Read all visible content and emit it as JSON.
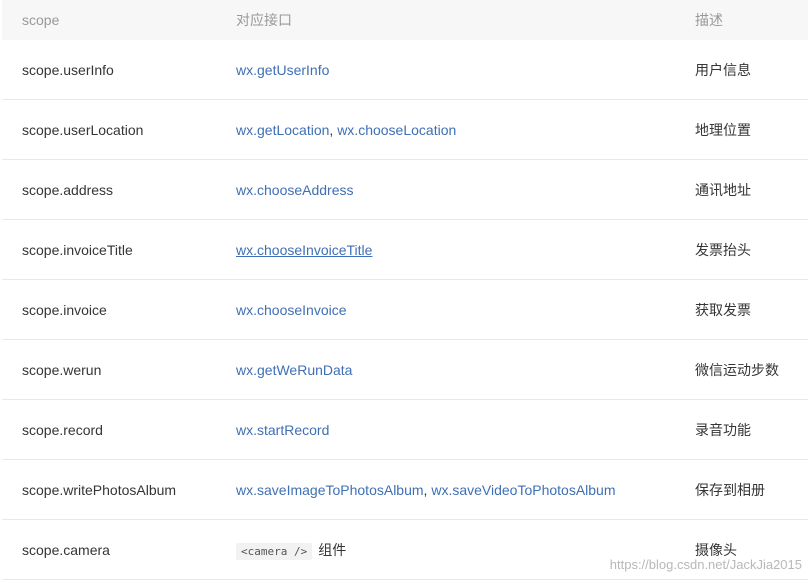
{
  "header": {
    "scope": "scope",
    "api": "对应接口",
    "desc": "描述"
  },
  "rows": [
    {
      "scope": "scope.userInfo",
      "apis": [
        "wx.getUserInfo"
      ],
      "desc": "用户信息"
    },
    {
      "scope": "scope.userLocation",
      "apis": [
        "wx.getLocation",
        "wx.chooseLocation"
      ],
      "sep": ", ",
      "desc": "地理位置"
    },
    {
      "scope": "scope.address",
      "apis": [
        "wx.chooseAddress"
      ],
      "desc": "通讯地址"
    },
    {
      "scope": "scope.invoiceTitle",
      "apis": [
        "wx.chooseInvoiceTitle"
      ],
      "desc": "发票抬头"
    },
    {
      "scope": "scope.invoice",
      "apis": [
        "wx.chooseInvoice"
      ],
      "desc": "获取发票"
    },
    {
      "scope": "scope.werun",
      "apis": [
        "wx.getWeRunData"
      ],
      "desc": "微信运动步数"
    },
    {
      "scope": "scope.record",
      "apis": [
        "wx.startRecord"
      ],
      "desc": "录音功能"
    },
    {
      "scope": "scope.writePhotosAlbum",
      "apis": [
        "wx.saveImageToPhotosAlbum",
        "wx.saveVideoToPhotosAlbum"
      ],
      "sep": ", ",
      "desc": "保存到相册"
    },
    {
      "scope": "scope.camera",
      "code": "<camera />",
      "component_label": "组件",
      "desc": "摄像头"
    }
  ],
  "watermark": "https://blog.csdn.net/JackJia2015",
  "colors": {
    "link": "#3f6fb5",
    "header_bg": "#f7f7f7",
    "row_border": "#e8e8e8"
  }
}
